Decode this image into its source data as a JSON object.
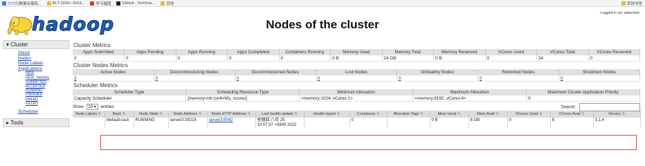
{
  "bookmarks": {
    "items": [
      {
        "label": "六六行数据合需和...",
        "color": "#3b7ddd"
      },
      {
        "label": "IR-T-3109—2014...",
        "color": "#e7b83a"
      },
      {
        "label": "学习福团",
        "color": "#d23b30"
      },
      {
        "label": "GitHub - TechXue...",
        "color": "#222222"
      },
      {
        "label": "其他",
        "color": "#e7b83a"
      }
    ],
    "other": "其他书签"
  },
  "header": {
    "logged_in": "Logged in as: alanchan",
    "logo_text": "hadoop",
    "title": "Nodes of the cluster"
  },
  "nav": {
    "cluster_label": "Cluster",
    "links": [
      "About",
      "Nodes",
      "Node Labels",
      "Applications"
    ],
    "app_states": [
      "NEW",
      "NEW_SAVING",
      "SUBMITTED",
      "ACCEPTED",
      "RUNNING",
      "FINISHED",
      "FAILED",
      "KILLED"
    ],
    "scheduler": "Scheduler",
    "tools_label": "Tools"
  },
  "cluster_metrics": {
    "title": "Cluster Metrics",
    "headers": [
      "Apps Submitted",
      "Apps Pending",
      "Apps Running",
      "Apps Completed",
      "Containers Running",
      "Memory Used",
      "Memory Total",
      "Memory Reserved",
      "VCores Used",
      "VCores Total",
      "VCores Reserved"
    ],
    "values": [
      "0",
      "0",
      "0",
      "0",
      "0",
      "0 B",
      "24 GB",
      "0 B",
      "0",
      "24",
      "0"
    ]
  },
  "node_metrics": {
    "title": "Cluster Nodes Metrics",
    "headers": [
      "Active Nodes",
      "Decommissioning Nodes",
      "Decommissioned Nodes",
      "Lost Nodes",
      "Unhealthy Nodes",
      "Rebooted Nodes",
      "Shutdown Nodes"
    ],
    "values": [
      "3",
      "0",
      "0",
      "0",
      "0",
      "0",
      "0"
    ]
  },
  "scheduler_metrics": {
    "title": "Scheduler Metrics",
    "headers": [
      "Scheduler Type",
      "Scheduling Resource Type",
      "Minimum Allocation",
      "Maximum Allocation",
      "Maximum Cluster Application Priority"
    ],
    "values": [
      "Capacity Scheduler",
      "[memory-mb (unit=Mi), vcores]",
      "<memory:1024, vCores:1>",
      "<memory:8192, vCores:4>",
      "0"
    ]
  },
  "table_controls": {
    "show_label": "Show",
    "show_value": "20",
    "entries_label": "entries",
    "search_label": "Search:"
  },
  "nodes_table": {
    "headers": [
      "Node Labels",
      "Rack",
      "Node State",
      "Node Address",
      "Node HTTP Address",
      "Last health-update",
      "Health-report",
      "Containers",
      "Allocation Tags",
      "Mem Used",
      "Mem Avail",
      "VCores Used",
      "VCores Avail",
      "Version"
    ],
    "row": [
      "",
      "/default-rack",
      "RUNNING",
      "server3:39218",
      "server3:8042",
      "星期四 八月 25 10:07:37 +0800 2022",
      "",
      "0",
      "",
      "0 B",
      "8 GB",
      "0",
      "8",
      "3.1.4"
    ]
  }
}
